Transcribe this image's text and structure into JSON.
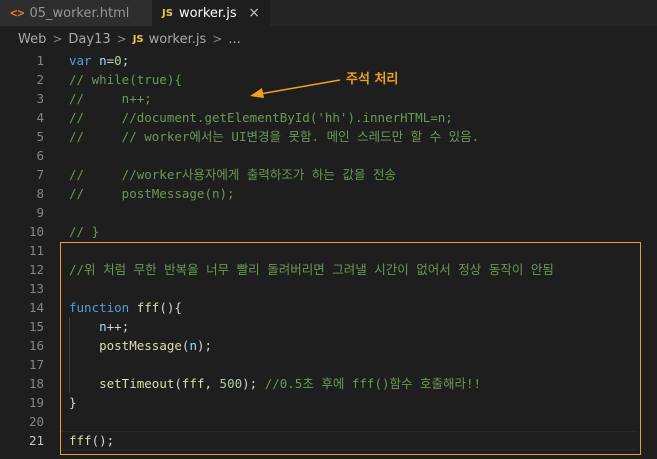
{
  "tabs": [
    {
      "icon": "html-file-icon",
      "icon_glyph": "<>",
      "label": "05_worker.html"
    },
    {
      "icon": "js-file-icon",
      "icon_glyph": "JS",
      "label": "worker.js",
      "close": "×"
    }
  ],
  "breadcrumb": {
    "items": [
      "Web",
      "Day13",
      "worker.js",
      "..."
    ],
    "sep": ">",
    "js_badge": "JS"
  },
  "annotation": "주석 처리",
  "colors": {
    "annotation": "#f0a020",
    "keyword": "#569cd6",
    "variable": "#9cdcfe",
    "function": "#dcdcaa",
    "number": "#b5cea8",
    "comment": "#6a9955"
  },
  "lines": [
    {
      "n": "1",
      "t": [
        [
          "kw",
          "var"
        ],
        [
          "pl",
          " "
        ],
        [
          "var",
          "n"
        ],
        [
          "pl",
          "="
        ],
        [
          "num",
          "0"
        ],
        [
          "pl",
          ";"
        ]
      ]
    },
    {
      "n": "2",
      "t": [
        [
          "cm",
          "// while(true){"
        ]
      ]
    },
    {
      "n": "3",
      "t": [
        [
          "cm",
          "//     n++;"
        ]
      ]
    },
    {
      "n": "4",
      "t": [
        [
          "cm",
          "//     //document.getElementById('hh').innerHTML=n;"
        ]
      ]
    },
    {
      "n": "5",
      "t": [
        [
          "cm",
          "//     // worker에서는 UI변경을 못함. 메인 스레드만 할 수 있음."
        ]
      ]
    },
    {
      "n": "6",
      "t": []
    },
    {
      "n": "7",
      "t": [
        [
          "cm",
          "//     //worker사용자에게 출력하조가 하는 값을 전송"
        ]
      ]
    },
    {
      "n": "8",
      "t": [
        [
          "cm",
          "//     postMessage(n);"
        ]
      ]
    },
    {
      "n": "9",
      "t": []
    },
    {
      "n": "10",
      "t": [
        [
          "cm",
          "// }"
        ]
      ]
    },
    {
      "n": "11",
      "t": []
    },
    {
      "n": "12",
      "t": [
        [
          "cm",
          "//위 처럼 무한 반복을 너무 빨리 돌려버리면 그려낼 시간이 없어서 정상 동작이 안됨"
        ]
      ]
    },
    {
      "n": "13",
      "t": []
    },
    {
      "n": "14",
      "t": [
        [
          "kw",
          "function"
        ],
        [
          "pl",
          " "
        ],
        [
          "fn",
          "fff"
        ],
        [
          "pl",
          "(){"
        ]
      ]
    },
    {
      "n": "15",
      "t": [
        [
          "pl",
          "    "
        ],
        [
          "var",
          "n"
        ],
        [
          "pl",
          "++;"
        ]
      ]
    },
    {
      "n": "16",
      "t": [
        [
          "pl",
          "    "
        ],
        [
          "fn",
          "postMessage"
        ],
        [
          "pl",
          "("
        ],
        [
          "var",
          "n"
        ],
        [
          "pl",
          ");"
        ]
      ]
    },
    {
      "n": "17",
      "t": []
    },
    {
      "n": "18",
      "t": [
        [
          "pl",
          "    "
        ],
        [
          "fn",
          "setTimeout"
        ],
        [
          "pl",
          "("
        ],
        [
          "fn",
          "fff"
        ],
        [
          "pl",
          ", "
        ],
        [
          "num",
          "500"
        ],
        [
          "pl",
          "); "
        ],
        [
          "cm",
          "//0.5초 후에 fff()함수 호출해라!!"
        ]
      ]
    },
    {
      "n": "19",
      "t": [
        [
          "pl",
          "}"
        ]
      ]
    },
    {
      "n": "20",
      "t": []
    },
    {
      "n": "21",
      "t": [
        [
          "fn",
          "fff"
        ],
        [
          "pl",
          "();"
        ]
      ]
    }
  ]
}
